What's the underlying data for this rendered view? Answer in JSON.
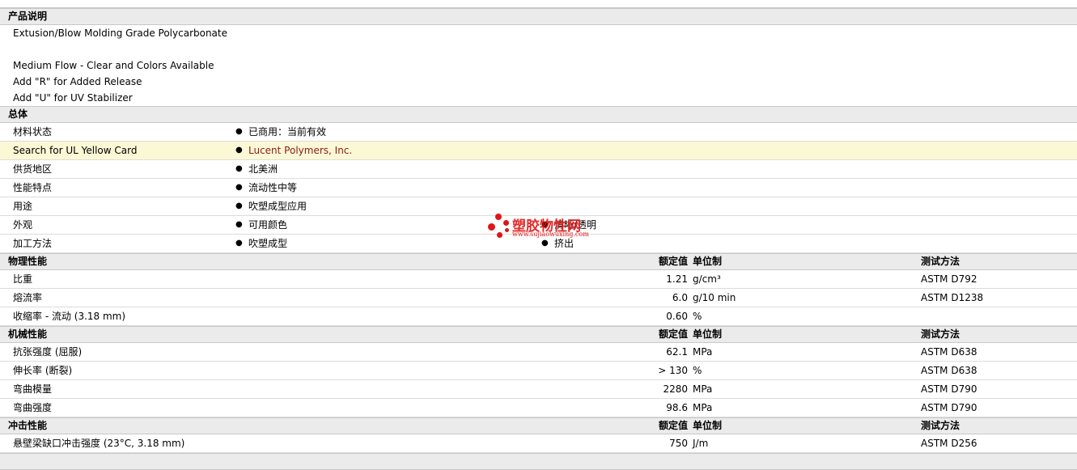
{
  "description": {
    "header": "产品说明",
    "lines": [
      "Extusion/Blow Molding Grade Polycarbonate",
      "",
      "Medium Flow - Clear and Colors Available",
      "Add \"R\" for Added Release",
      "Add \"U\" for UV Stabilizer"
    ]
  },
  "general": {
    "header": "总体",
    "rows": [
      {
        "label": "材料状态",
        "v1": "已商用：当前有效"
      },
      {
        "label": "Search for UL Yellow Card",
        "v1": "Lucent Polymers, Inc."
      },
      {
        "label": "供货地区",
        "v1": "北美洲"
      },
      {
        "label": "性能特点",
        "v1": "流动性中等"
      },
      {
        "label": "用途",
        "v1": "吹塑成型应用"
      },
      {
        "label": "外观",
        "v1": "可用颜色",
        "v2": "清晰/透明"
      },
      {
        "label": "加工方法",
        "v1": "吹塑成型",
        "v2": "挤出"
      }
    ]
  },
  "columns": {
    "nominal": "额定值",
    "unit": "单位制",
    "test": "测试方法"
  },
  "physical": {
    "header": "物理性能",
    "rows": [
      {
        "label": "比重",
        "value": "1.21",
        "unit": "g/cm³",
        "test": "ASTM D792"
      },
      {
        "label": "熔流率",
        "value": "6.0",
        "unit": "g/10 min",
        "test": "ASTM D1238"
      },
      {
        "label": "收缩率  - 流动  (3.18 mm)",
        "value": "0.60",
        "unit": "%",
        "test": ""
      }
    ]
  },
  "mechanical": {
    "header": "机械性能",
    "rows": [
      {
        "label": "抗张强度  (屈服)",
        "value": "62.1",
        "unit": "MPa",
        "test": "ASTM D638"
      },
      {
        "label": "伸长率  (断裂)",
        "value": "> 130",
        "unit": "%",
        "test": "ASTM D638"
      },
      {
        "label": "弯曲模量",
        "value": "2280",
        "unit": "MPa",
        "test": "ASTM D790"
      },
      {
        "label": "弯曲强度",
        "value": "98.6",
        "unit": "MPa",
        "test": "ASTM D790"
      }
    ]
  },
  "impact": {
    "header": "冲击性能",
    "rows": [
      {
        "label": "悬壁梁缺口冲击强度  (23°C, 3.18 mm)",
        "value": "750",
        "unit": "J/m",
        "test": "ASTM D256"
      }
    ]
  },
  "watermark": {
    "text": "塑胶物性网",
    "url": "www.sujiaowuxing.com"
  },
  "colors": {
    "header_bg": "#ebebeb",
    "highlight_bg": "#fbf8d5",
    "link": "#8b1a1a",
    "watermark": "#e01515"
  }
}
